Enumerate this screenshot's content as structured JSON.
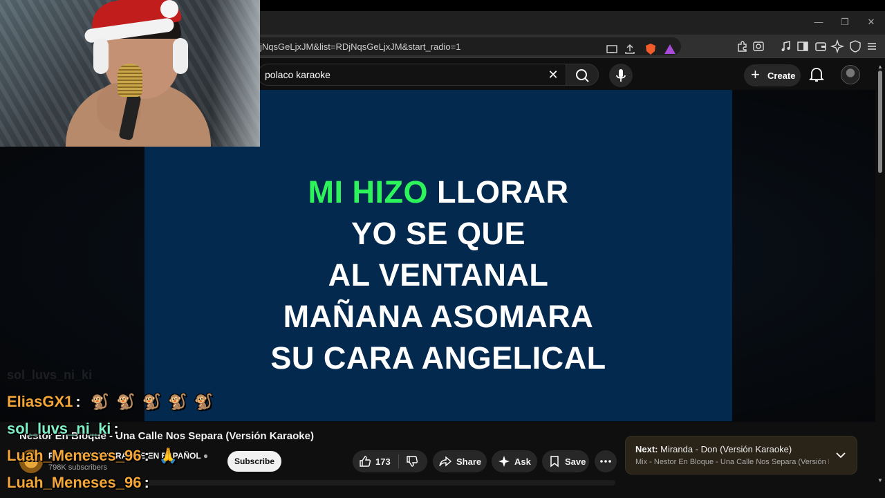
{
  "browser": {
    "url": "jNqsGeLjxJM&list=RDjNqsGeLjxJM&start_radio=1",
    "win_minimize": "—",
    "win_restore": "❐",
    "win_close": "✕"
  },
  "youtube": {
    "search_value": "polaco karaoke",
    "create_label": "Create"
  },
  "lyrics": {
    "line1_highlight": "MI HIZO",
    "line1_rest": " LLORAR",
    "line2": "YO SE QUE",
    "line3": "AL VENTANAL",
    "line4": "MAÑANA ASOMARA",
    "line5": "SU CARA ANGELICAL"
  },
  "video": {
    "title": "Nestor En Bloque - Una Calle Nos Separa (Versión Karaoke)",
    "channel_name": "PARTY TYME KARAOKE EN ESPAÑOL",
    "subscribers": "798K subscribers",
    "subscribe_label": "Subscribe",
    "likes": "173",
    "share_label": "Share",
    "ask_label": "Ask",
    "save_label": "Save"
  },
  "up_next": {
    "prefix": "Next:",
    "title": " Miranda - Don (Versión Karaoke)",
    "subtitle": "Mix - Nestor En Bloque - Una Calle Nos Separa (Versión Kara..."
  },
  "chat": [
    {
      "user": "EliasGX1",
      "colon": ":",
      "emote": "🐒"
    },
    {
      "user": "sol_luvs_ni_ki",
      "colon": ":"
    },
    {
      "user": "Luah_Meneses_96",
      "colon": ":",
      "emote": "🙏"
    },
    {
      "user": "Luah_Meneses_96",
      "colon": ":"
    }
  ],
  "chat_ghost": "sol_luvs_ni_ki",
  "colors": {
    "lyric_highlight": "#2cf45a",
    "player_bg": "#04294f",
    "chat_user": "#f5a638",
    "chat_user_alt": "#7ff0c8"
  },
  "icons": [
    "search-icon",
    "close-icon",
    "mic-icon",
    "plus-icon",
    "bell-icon",
    "like-icon",
    "dislike-icon",
    "share-icon",
    "sparkle-icon",
    "bookmark-icon",
    "more-icon",
    "chevron-down-icon",
    "verified-icon"
  ]
}
